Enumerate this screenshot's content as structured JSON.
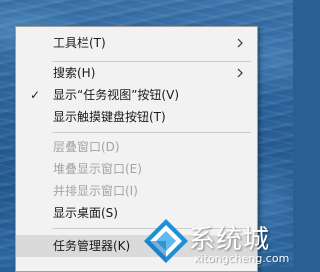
{
  "menu": {
    "items": [
      {
        "label": "工具栏(T)",
        "submenu": true,
        "disabled": false
      },
      {
        "label": "搜索(H)",
        "submenu": true,
        "disabled": false
      },
      {
        "label": "显示“任务视图”按钮(V)",
        "checked": true,
        "disabled": false
      },
      {
        "label": "显示触摸键盘按钮(T)",
        "disabled": false
      },
      {
        "label": "层叠窗口(D)",
        "disabled": true
      },
      {
        "label": "堆叠显示窗口(E)",
        "disabled": true
      },
      {
        "label": "并排显示窗口(I)",
        "disabled": true
      },
      {
        "label": "显示桌面(S)",
        "disabled": false
      },
      {
        "label": "任务管理器(K)",
        "disabled": false,
        "highlighted": true
      }
    ],
    "check_glyph": "✓"
  },
  "watermark": {
    "brand": "系统城",
    "url": "xitongcheng.com",
    "colors": {
      "blue": "#1e8fd9",
      "light_blue": "#5fb8f0",
      "white": "#ffffff"
    }
  }
}
